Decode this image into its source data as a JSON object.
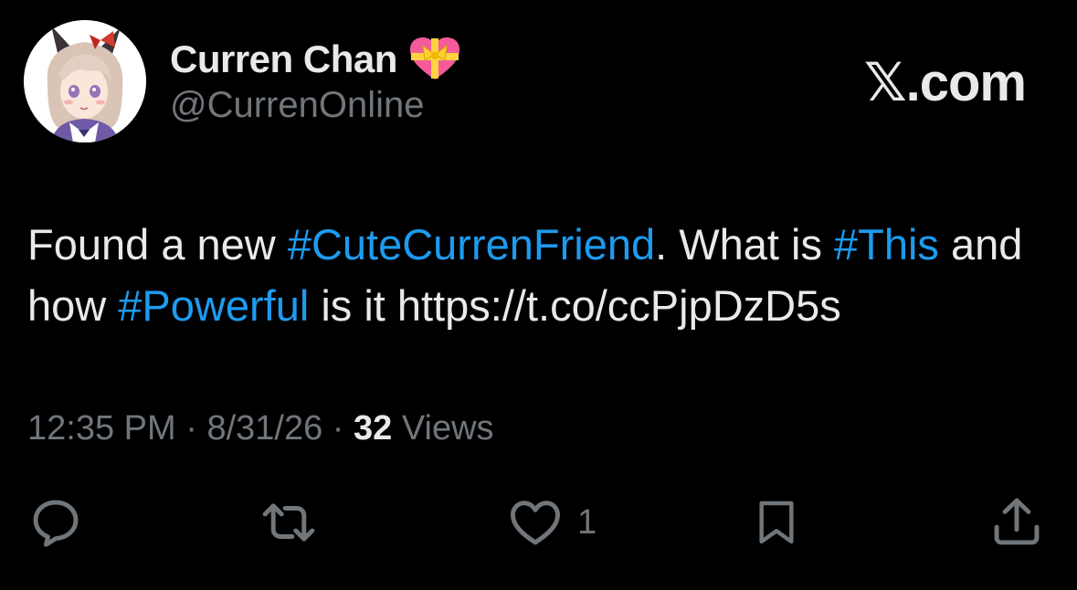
{
  "author": {
    "display_name": "Curren Chan",
    "name_emoji": "heart-with-ribbon",
    "handle": "@CurrenOnline",
    "avatar": "anime-character-avatar"
  },
  "site": {
    "label": "𝕏.com"
  },
  "tweet": {
    "t1": "Found a new ",
    "tag1": "#CuteCurrenFriend",
    "t2": ". What is ",
    "tag2": "#This",
    "t3": " and how ",
    "tag3": "#Powerful",
    "t4": " is it https://t.co/ccPjpDzD5s"
  },
  "meta": {
    "time": "12:35 PM",
    "sep1": " · ",
    "date": "8/31/26",
    "sep2": " · ",
    "views_count": "32",
    "views_label": " Views"
  },
  "actions": {
    "reply_icon": "speech-bubble",
    "retweet_icon": "retweet-arrows",
    "like_icon": "heart-outline",
    "like_count": "1",
    "bookmark_icon": "bookmark-outline",
    "share_icon": "upload-share"
  },
  "colors": {
    "background": "#000000",
    "text": "#e7e9ea",
    "muted": "#71767b",
    "link": "#1d9bf0"
  }
}
